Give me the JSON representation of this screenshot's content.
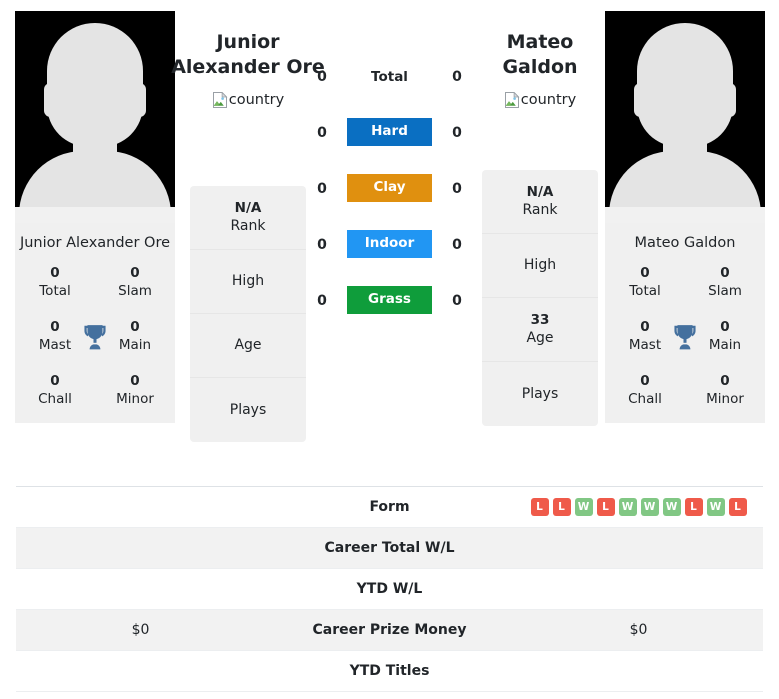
{
  "players": {
    "left": {
      "photo_alt": "player-photo",
      "display_name": "Junior\nAlexander Ore",
      "first_line": "Junior",
      "second_line": "Alexander Ore",
      "country_alt": "country",
      "panel_name": "Junior Alexander Ore",
      "titles": [
        {
          "value": "0",
          "label": "Total"
        },
        {
          "value": "0",
          "label": "Slam"
        },
        {
          "value": "0",
          "label": "Mast"
        },
        {
          "value": "0",
          "label": "Main"
        },
        {
          "value": "0",
          "label": "Chall"
        },
        {
          "value": "0",
          "label": "Minor"
        }
      ],
      "info": [
        {
          "value": "N/A",
          "label": "Rank"
        },
        {
          "value": "",
          "label": "High"
        },
        {
          "value": "",
          "label": "Age"
        },
        {
          "value": "",
          "label": "Plays"
        }
      ]
    },
    "right": {
      "photo_alt": "player-photo",
      "first_line": "Mateo",
      "second_line": "Galdon",
      "country_alt": "country",
      "panel_name": "Mateo Galdon",
      "titles": [
        {
          "value": "0",
          "label": "Total"
        },
        {
          "value": "0",
          "label": "Slam"
        },
        {
          "value": "0",
          "label": "Mast"
        },
        {
          "value": "0",
          "label": "Main"
        },
        {
          "value": "0",
          "label": "Chall"
        },
        {
          "value": "0",
          "label": "Minor"
        }
      ],
      "info": [
        {
          "value": "N/A",
          "label": "Rank"
        },
        {
          "value": "",
          "label": "High"
        },
        {
          "value": "33",
          "label": "Age"
        },
        {
          "value": "",
          "label": "Plays"
        }
      ]
    }
  },
  "surfaces": [
    {
      "label": "Total",
      "left": "0",
      "right": "0",
      "style": "plain",
      "color": ""
    },
    {
      "label": "Hard",
      "left": "0",
      "right": "0",
      "style": "badge",
      "color": "#0a6fc2"
    },
    {
      "label": "Clay",
      "left": "0",
      "right": "0",
      "style": "badge",
      "color": "#e0900f"
    },
    {
      "label": "Indoor",
      "left": "0",
      "right": "0",
      "style": "badge",
      "color": "#2196f3"
    },
    {
      "label": "Grass",
      "left": "0",
      "right": "0",
      "style": "badge",
      "color": "#0f9d3b"
    }
  ],
  "comparison_rows": [
    {
      "label": "Form",
      "left_value": "",
      "right_value": "",
      "striped": false,
      "right_form": [
        "L",
        "L",
        "W",
        "L",
        "W",
        "W",
        "W",
        "L",
        "W",
        "L"
      ],
      "left_form": []
    },
    {
      "label": "Career Total W/L",
      "left_value": "",
      "right_value": "",
      "striped": true,
      "right_form": [],
      "left_form": []
    },
    {
      "label": "YTD W/L",
      "left_value": "",
      "right_value": "",
      "striped": false,
      "right_form": [],
      "left_form": []
    },
    {
      "label": "Career Prize Money",
      "left_value": "$0",
      "right_value": "$0",
      "striped": true,
      "right_form": [],
      "left_form": []
    },
    {
      "label": "YTD Titles",
      "left_value": "",
      "right_value": "",
      "striped": false,
      "right_form": [],
      "left_form": []
    }
  ],
  "colors": {
    "form_win": "#ef5a4a",
    "form_loss": "#ef5a4a",
    "win": "#81c784",
    "loss": "#ef5a4a",
    "trophy": "#44709e",
    "card_bg": "#f0f0f0",
    "stripe_bg": "#f2f2f2"
  }
}
